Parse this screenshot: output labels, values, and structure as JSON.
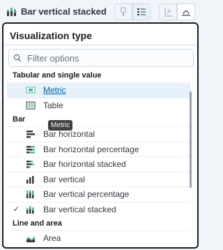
{
  "toolbar": {
    "visualization_label": "Bar vertical stacked",
    "chart_icon": "bar-stacked-icon",
    "buttons": [
      {
        "name": "palette-icon",
        "state": "disabled"
      },
      {
        "name": "list-settings-icon",
        "state": "normal"
      },
      {
        "name": "axis-left-icon",
        "state": "disabled"
      },
      {
        "name": "axis-bottom-icon",
        "state": "normal"
      }
    ]
  },
  "popover": {
    "title": "Visualization type",
    "search": {
      "placeholder": "Filter options",
      "value": "",
      "icon": "search-icon"
    },
    "groups": [
      {
        "label": "Tabular and single value",
        "options": [
          {
            "label": "Metric",
            "icon": "metric-icon",
            "hovered": true
          },
          {
            "label": "Table",
            "icon": "table-icon"
          }
        ]
      },
      {
        "label": "Bar",
        "options": [
          {
            "label": "Bar horizontal",
            "icon": "bar-horizontal-icon"
          },
          {
            "label": "Bar horizontal percentage",
            "icon": "bar-horizontal-percentage-icon"
          },
          {
            "label": "Bar horizontal stacked",
            "icon": "bar-horizontal-stacked-icon"
          },
          {
            "label": "Bar vertical",
            "icon": "bar-vertical-icon"
          },
          {
            "label": "Bar vertical percentage",
            "icon": "bar-vertical-percentage-icon"
          },
          {
            "label": "Bar vertical stacked",
            "icon": "bar-vertical-stacked-icon",
            "selected": true
          }
        ]
      },
      {
        "label": "Line and area",
        "options": [
          {
            "label": "Area",
            "icon": "area-icon"
          }
        ]
      }
    ],
    "tooltip": "Metric"
  },
  "colors": {
    "accent": "#0061a6",
    "hover_bg": "#e6f1fa",
    "border_dark": "#1a1c21",
    "icon_green": "#54b399",
    "icon_dark": "#343741"
  }
}
